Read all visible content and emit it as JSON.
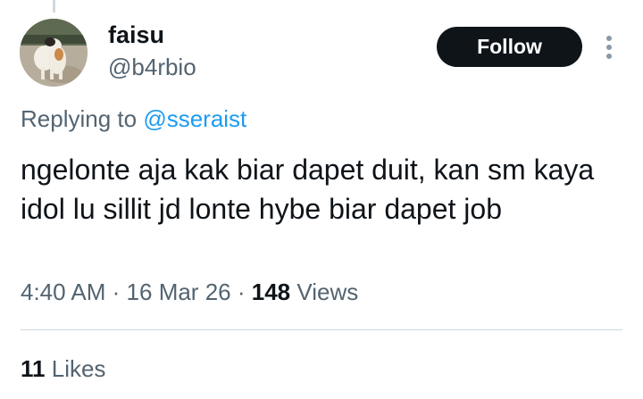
{
  "tweet": {
    "author": {
      "display_name": "faisu",
      "handle": "@b4rbio"
    },
    "follow_label": "Follow",
    "replying_prefix": "Replying to",
    "replying_to": "@sseraist",
    "text": "ngelonte aja kak biar dapet duit, kan sm kaya idol lu sillit jd lonte hybe biar dapet job",
    "time": "4:40 AM",
    "separator": "·",
    "date": "16 Mar 26",
    "views_count": "148",
    "views_label": "Views",
    "likes_count": "11",
    "likes_label": "Likes"
  },
  "icons": {
    "more": "more-vertical-icon",
    "avatar": "cat-photo-avatar"
  },
  "colors": {
    "text_primary": "#0f1419",
    "text_secondary": "#536471",
    "link": "#1d9bf0",
    "button_bg": "#0f1419",
    "divider": "#cfd9de"
  }
}
